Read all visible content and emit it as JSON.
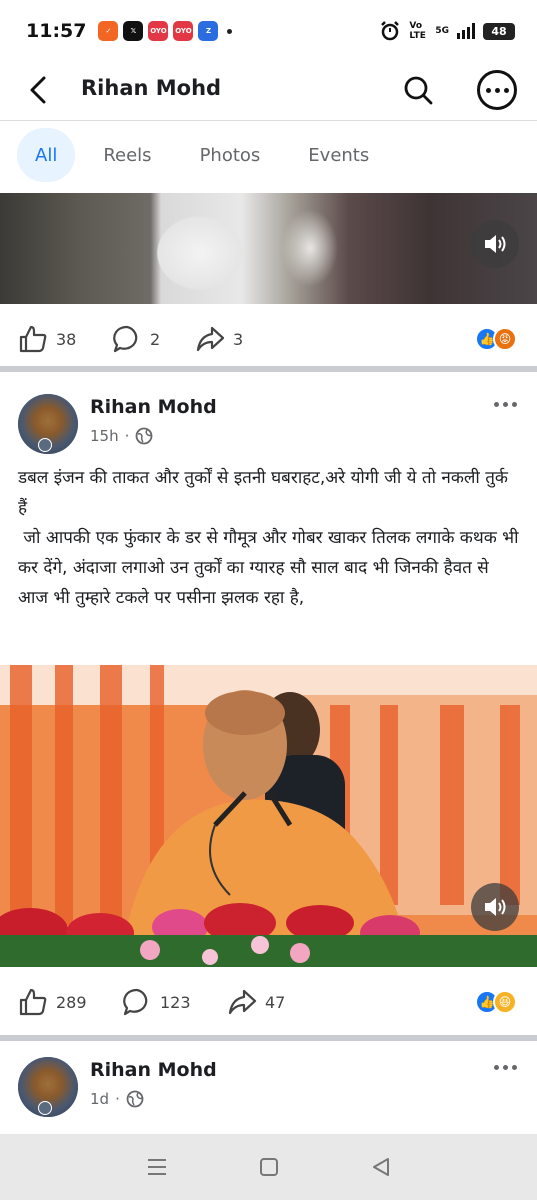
{
  "status_bar": {
    "time": "11:57",
    "signal_text": "Vo LTE",
    "network": "5G",
    "battery": "48"
  },
  "header": {
    "title": "Rihan Mohd"
  },
  "tabs": [
    {
      "label": "All",
      "active": true
    },
    {
      "label": "Reels",
      "active": false
    },
    {
      "label": "Photos",
      "active": false
    },
    {
      "label": "Events",
      "active": false
    }
  ],
  "post1": {
    "likes": "38",
    "comments": "2",
    "shares": "3",
    "reactions": [
      "like",
      "angry"
    ]
  },
  "post2": {
    "author": "Rihan Mohd",
    "time": "15h",
    "privacy": "globe-icon",
    "text_line1": "डबल इंजन की ताकत और तुर्कों से इतनी घबराहट,अरे योगी जी ये तो नकली तुर्क हैं",
    "text_line2": " जो आपकी एक फुंकार के डर से गौमूत्र और गोबर खाकर तिलक लगाके कथक भी कर देंगे, अंदाजा लगाओ उन तुर्कों का ग्यारह सौ साल बाद भी जिनकी हैवत से आज भी तुम्हारे टकले पर पसीना झलक रहा है,",
    "likes": "289",
    "comments": "123",
    "shares": "47",
    "reactions": [
      "like",
      "haha"
    ]
  },
  "post3": {
    "author": "Rihan Mohd",
    "time": "1d"
  },
  "colors": {
    "accent": "#1877f2",
    "tab_active_bg": "#e7f3ff",
    "text_secondary": "#65676b"
  }
}
